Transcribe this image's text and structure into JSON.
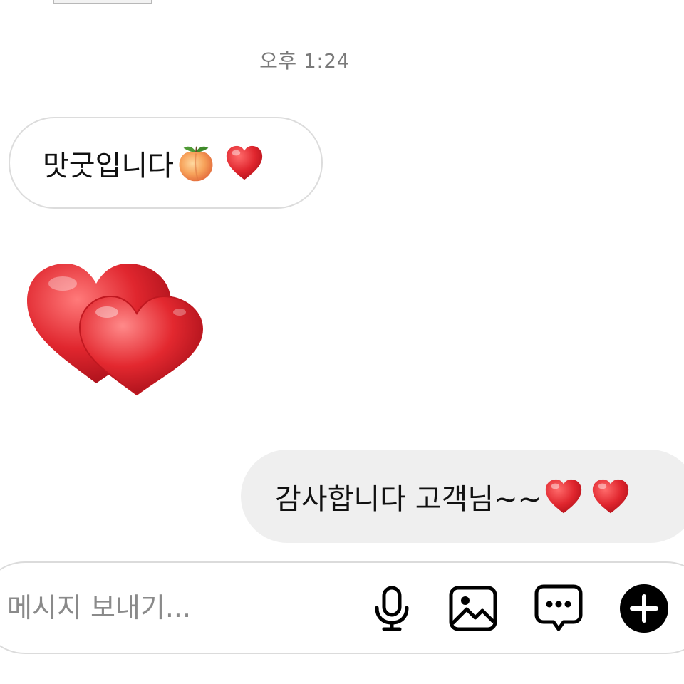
{
  "chat": {
    "timestamp": "오후 1:24",
    "messages": [
      {
        "direction": "incoming",
        "text": "맛굿입니다",
        "emojis": [
          "peach-emoji",
          "red-heart-emoji"
        ]
      },
      {
        "direction": "incoming",
        "sticker": "double-red-hearts-sticker"
      },
      {
        "direction": "outgoing",
        "text": "감사합니다 고객님~~",
        "emojis": [
          "red-heart-emoji",
          "red-heart-emoji"
        ]
      }
    ]
  },
  "composer": {
    "placeholder": "메시지 보내기...",
    "icons": [
      "microphone-icon",
      "image-icon",
      "chat-bubble-dots-icon",
      "plus-circle-icon"
    ]
  },
  "colors": {
    "incoming_bubble_border": "#dcdcdc",
    "outgoing_bubble_bg": "#efefef",
    "heart_red": "#e0262e",
    "timestamp_gray": "#7a7a7a",
    "placeholder_gray": "#8a8a8a",
    "icon_black": "#000000"
  }
}
